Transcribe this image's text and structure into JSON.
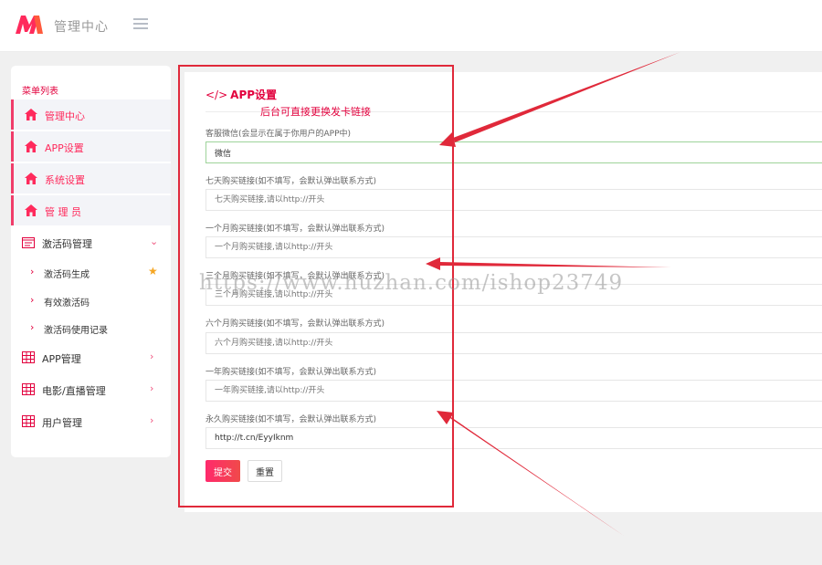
{
  "header": {
    "app_title": "管理中心",
    "menu_toggle_icon": "hamburger-icon",
    "brand_color": "#ff2a5c"
  },
  "sidebar": {
    "title": "菜单列表",
    "items": [
      {
        "label": "管理中心",
        "icon": "home-icon",
        "active": true
      },
      {
        "label": "APP设置",
        "icon": "home-icon",
        "active": true
      },
      {
        "label": "系统设置",
        "icon": "home-icon",
        "active": true
      },
      {
        "label": "管 理 员",
        "icon": "home-icon",
        "active": true
      },
      {
        "label": "激活码管理",
        "icon": "calendar-icon",
        "expanded": true,
        "chevron": "⌄"
      },
      {
        "label": "APP管理",
        "icon": "table-icon",
        "chevron": "›"
      },
      {
        "label": "电影/直播管理",
        "icon": "table-icon",
        "chevron": "›"
      },
      {
        "label": "用户管理",
        "icon": "table-icon",
        "chevron": "›"
      }
    ],
    "subitems": [
      {
        "label": "激活码生成",
        "arrow": "›",
        "starred": true,
        "star": "★"
      },
      {
        "label": "有效激活码",
        "arrow": "›"
      },
      {
        "label": "激活码使用记录",
        "arrow": "›"
      }
    ]
  },
  "main": {
    "section_title_icon": "</>",
    "section_title": "APP设置",
    "annotation": "后台可直接更换发卡链接",
    "fields": [
      {
        "label": "客服微信(会显示在属于你用户的APP中)",
        "value": "微信",
        "placeholder": ""
      },
      {
        "label": "七天购买链接(如不填写，会默认弹出联系方式)",
        "value": "",
        "placeholder": "七天购买链接,请以http://开头"
      },
      {
        "label": "一个月购买链接(如不填写，会默认弹出联系方式)",
        "value": "",
        "placeholder": "一个月购买链接,请以http://开头"
      },
      {
        "label": "三个月购买链接(如不填写，会默认弹出联系方式)",
        "value": "",
        "placeholder": "三个月购买链接,请以http://开头"
      },
      {
        "label": "六个月购买链接(如不填写，会默认弹出联系方式)",
        "value": "",
        "placeholder": "六个月购买链接,请以http://开头"
      },
      {
        "label": "一年购买链接(如不填写，会默认弹出联系方式)",
        "value": "",
        "placeholder": "一年购买链接,请以http://开头"
      },
      {
        "label": "永久购买链接(如不填写，会默认弹出联系方式)",
        "value": "http://t.cn/EyyIknm",
        "placeholder": ""
      }
    ],
    "submit_label": "提交",
    "reset_label": "重置"
  },
  "watermark": "https://www.huzhan.com/ishop23749"
}
